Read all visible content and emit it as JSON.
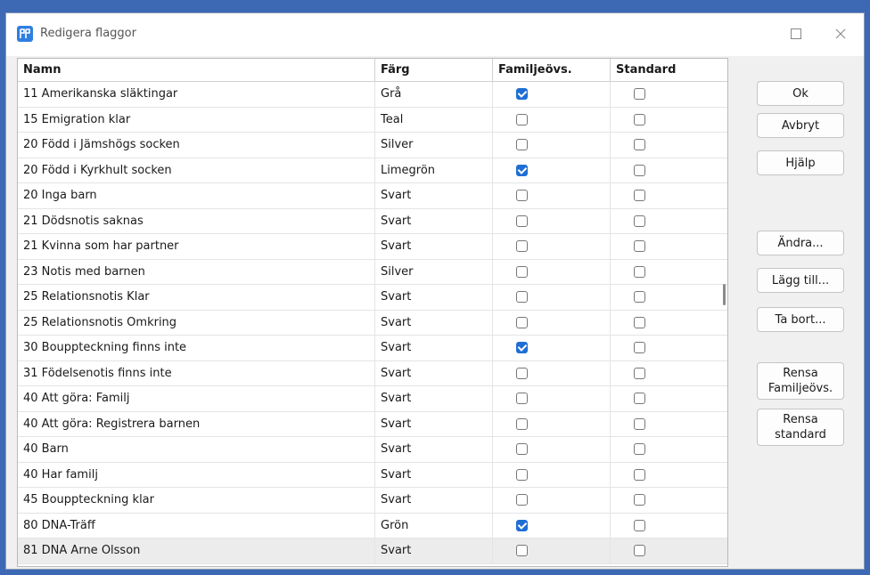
{
  "window": {
    "title": "Redigera flaggor"
  },
  "table": {
    "headers": {
      "name": "Namn",
      "color": "Färg",
      "family": "Familjeövs.",
      "standard": "Standard"
    },
    "rows": [
      {
        "name": "11 Amerikanska släktingar",
        "color": "Grå",
        "family": true,
        "standard": false
      },
      {
        "name": "15 Emigration klar",
        "color": "Teal",
        "family": false,
        "standard": false
      },
      {
        "name": "20 Född i Jämshögs socken",
        "color": "Silver",
        "family": false,
        "standard": false
      },
      {
        "name": "20 Född i Kyrkhult socken",
        "color": "Limegrön",
        "family": true,
        "standard": false
      },
      {
        "name": "20 Inga barn",
        "color": "Svart",
        "family": false,
        "standard": false
      },
      {
        "name": "21 Dödsnotis saknas",
        "color": "Svart",
        "family": false,
        "standard": false
      },
      {
        "name": "21 Kvinna som har partner",
        "color": "Svart",
        "family": false,
        "standard": false
      },
      {
        "name": "23 Notis med barnen",
        "color": "Silver",
        "family": false,
        "standard": false
      },
      {
        "name": "25 Relationsnotis Klar",
        "color": "Svart",
        "family": false,
        "standard": false
      },
      {
        "name": "25 Relationsnotis Omkring",
        "color": "Svart",
        "family": false,
        "standard": false
      },
      {
        "name": "30 Bouppteckning finns inte",
        "color": "Svart",
        "family": true,
        "standard": false
      },
      {
        "name": "31 Födelsenotis finns inte",
        "color": "Svart",
        "family": false,
        "standard": false
      },
      {
        "name": "40 Att göra: Familj",
        "color": "Svart",
        "family": false,
        "standard": false
      },
      {
        "name": "40 Att göra: Registrera barnen",
        "color": "Svart",
        "family": false,
        "standard": false
      },
      {
        "name": "40 Barn",
        "color": "Svart",
        "family": false,
        "standard": false
      },
      {
        "name": "40 Har familj",
        "color": "Svart",
        "family": false,
        "standard": false
      },
      {
        "name": "45 Bouppteckning klar",
        "color": "Svart",
        "family": false,
        "standard": false
      },
      {
        "name": "80 DNA-Träff",
        "color": "Grön",
        "family": true,
        "standard": false
      },
      {
        "name": "81 DNA Arne Olsson",
        "color": "Svart",
        "family": false,
        "standard": false
      }
    ]
  },
  "buttons": {
    "ok": "Ok",
    "cancel": "Avbryt",
    "help": "Hjälp",
    "edit": "Ändra...",
    "add": "Lägg till...",
    "remove": "Ta bort...",
    "clear_family": "Rensa Familjeövs.",
    "clear_standard": "Rensa standard"
  },
  "colors": {
    "accent": "#1f6ed4",
    "frame": "#3d68b4"
  },
  "icons": {
    "app": "flags-icon",
    "maximize": "maximize-icon",
    "close": "close-icon"
  }
}
